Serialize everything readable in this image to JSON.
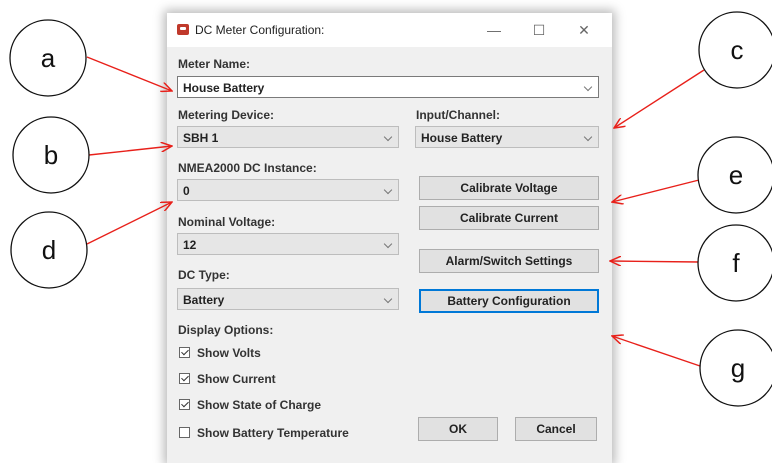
{
  "window": {
    "title": "DC Meter Configuration:",
    "minimize_icon": "minimize-icon",
    "maximize_icon": "maximize-icon",
    "close_icon": "close-icon"
  },
  "meter_name": {
    "label": "Meter Name:",
    "value": "House Battery"
  },
  "metering_device": {
    "label": "Metering Device:",
    "value": "SBH 1"
  },
  "input_channel": {
    "label": "Input/Channel:",
    "value": "House Battery"
  },
  "nmea_instance": {
    "label": "NMEA2000 DC Instance:",
    "value": "0"
  },
  "nominal_voltage": {
    "label": "Nominal Voltage:",
    "value": "12"
  },
  "dc_type": {
    "label": "DC Type:",
    "value": "Battery"
  },
  "buttons": {
    "calibrate_voltage": "Calibrate Voltage",
    "calibrate_current": "Calibrate Current",
    "alarm_switch": "Alarm/Switch Settings",
    "battery_config": "Battery Configuration",
    "ok": "OK",
    "cancel": "Cancel"
  },
  "display_options": {
    "label": "Display Options:",
    "items": [
      {
        "label": "Show Volts",
        "checked": true
      },
      {
        "label": "Show Current",
        "checked": true
      },
      {
        "label": "Show State of Charge",
        "checked": true
      },
      {
        "label": "Show Battery Temperature",
        "checked": false
      }
    ]
  },
  "annotations": {
    "a": "a",
    "b": "b",
    "c": "c",
    "d": "d",
    "e": "e",
    "f": "f",
    "g": "g",
    "arrow_color": "#e8201a"
  }
}
